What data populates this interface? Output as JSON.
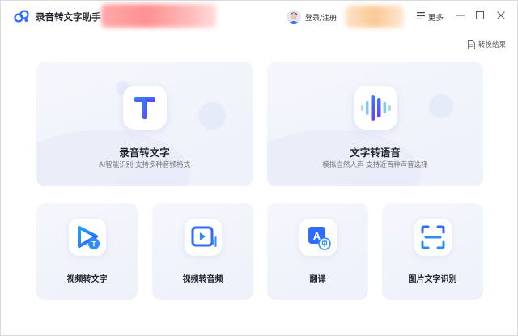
{
  "app": {
    "title": "录音转文字助手"
  },
  "header": {
    "login_label": "登录/注册",
    "menu_label": "更多"
  },
  "toolbar": {
    "results_label": "转换结果"
  },
  "features": [
    {
      "title": "录音转文字",
      "subtitle": "AI智能识别 支持多种音频格式",
      "icon": "t-letter-icon"
    },
    {
      "title": "文字转语音",
      "subtitle": "模拟自然人声 支持近百种声音选择",
      "icon": "voice-wave-icon"
    }
  ],
  "tools": [
    {
      "title": "视频转文字",
      "icon": "video-to-text-icon"
    },
    {
      "title": "视频转音频",
      "icon": "video-to-audio-icon"
    },
    {
      "title": "翻译",
      "icon": "translate-icon"
    },
    {
      "title": "图片文字识别",
      "icon": "image-ocr-icon"
    }
  ],
  "colors": {
    "brand": "#2f6bff",
    "accent_purple": "#6a3cf5",
    "card_bg": "#f3f5fc"
  }
}
